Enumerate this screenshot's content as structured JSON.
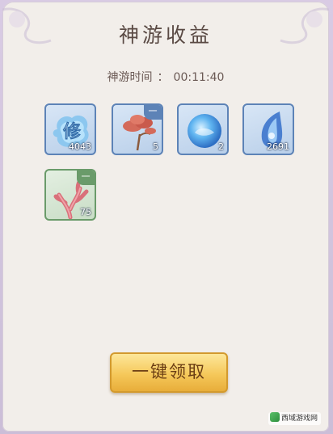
{
  "panel": {
    "title": "神游收益",
    "time_label": "神游时间",
    "time_separator": "：",
    "time_value": "00:11:40"
  },
  "rewards": [
    {
      "name": "修",
      "icon": "cultivation-glyph-icon",
      "count": "4043",
      "tag": "",
      "rarity": "blue"
    },
    {
      "name": "",
      "icon": "red-flower-icon",
      "count": "5",
      "tag": "一",
      "rarity": "blue"
    },
    {
      "name": "",
      "icon": "blue-orb-icon",
      "count": "2",
      "tag": "",
      "rarity": "blue"
    },
    {
      "name": "",
      "icon": "blue-crystal-icon",
      "count": "2691",
      "tag": "",
      "rarity": "blue"
    },
    {
      "name": "",
      "icon": "red-coral-icon",
      "count": "75",
      "tag": "一",
      "rarity": "green"
    }
  ],
  "claim_button_label": "一键领取",
  "watermark": "西域游戏网",
  "colors": {
    "rarity_blue": "#5d83b7",
    "rarity_green": "#6a9b6a",
    "button_gold": "#f5c85a"
  }
}
